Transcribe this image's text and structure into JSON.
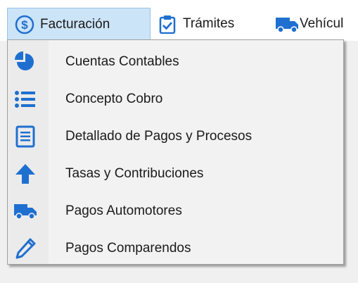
{
  "menubar": {
    "items": [
      {
        "label": "Facturación",
        "icon": "dollar-circle-icon",
        "active": true
      },
      {
        "label": "Trámites",
        "icon": "clipboard-check-icon"
      },
      {
        "label": "Vehícul",
        "icon": "truck-icon"
      }
    ]
  },
  "dropdown": {
    "items": [
      {
        "label": "Cuentas Contables",
        "icon": "pie-chart-icon"
      },
      {
        "label": "Concepto Cobro",
        "icon": "list-icon"
      },
      {
        "label": "Detallado de Pagos y Procesos",
        "icon": "document-icon"
      },
      {
        "label": "Tasas y Contribuciones",
        "icon": "arrow-up-icon"
      },
      {
        "label": "Pagos Automotores",
        "icon": "truck-icon"
      },
      {
        "label": "Pagos Comparendos",
        "icon": "pencil-icon"
      }
    ]
  },
  "colors": {
    "icon_blue": "#1f6fd0",
    "active_bg": "#cce4f7"
  }
}
